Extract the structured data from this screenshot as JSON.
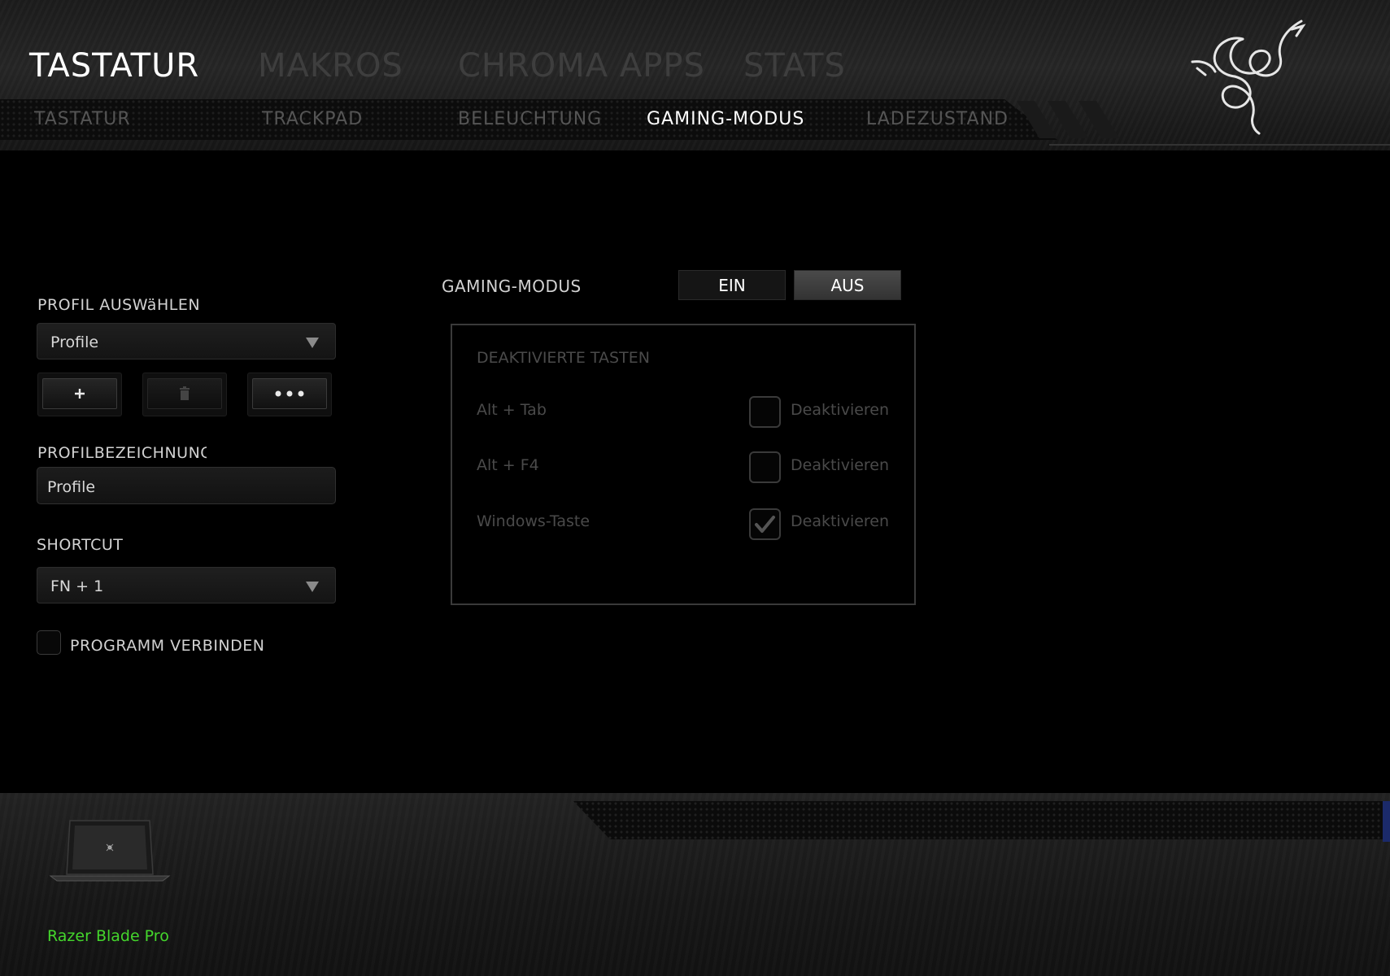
{
  "main_tabs": [
    {
      "label": "TASTATUR",
      "active": true
    },
    {
      "label": "MAKROS",
      "active": false
    },
    {
      "label": "CHROMA APPS",
      "active": false
    },
    {
      "label": "STATS",
      "active": false
    }
  ],
  "sub_tabs": [
    {
      "label": "TASTATUR",
      "active": false
    },
    {
      "label": "TRACKPAD",
      "active": false
    },
    {
      "label": "BELEUCHTUNG",
      "active": false
    },
    {
      "label": "GAMING-MODUS",
      "active": true
    },
    {
      "label": "LADEZUSTAND",
      "active": false
    }
  ],
  "profile": {
    "select_label": "PROFIL AUSWäHLEN",
    "selected": "Profile",
    "add_icon": "plus-icon",
    "delete_icon": "trash-icon",
    "more_icon": "ellipsis-icon",
    "name_label": "PROFILBEZEICHNUNG",
    "name_value": "Profile",
    "shortcut_label": "SHORTCUT",
    "shortcut_value": "FN + 1",
    "link_program_label": "PROGRAMM VERBINDEN",
    "link_program_checked": false
  },
  "gaming_mode": {
    "label": "GAMING-MODUS",
    "on_label": "EIN",
    "off_label": "AUS",
    "state": "AUS",
    "panel_title": "DEAKTIVIERTE TASTEN",
    "keys": [
      {
        "name": "Alt + Tab",
        "option": "Deaktivieren",
        "checked": false
      },
      {
        "name": "Alt + F4",
        "option": "Deaktivieren",
        "checked": false
      },
      {
        "name": "Windows-Taste",
        "option": "Deaktivieren",
        "checked": true
      }
    ]
  },
  "device": {
    "name": "Razer Blade Pro",
    "icon": "laptop-icon"
  },
  "colors": {
    "accent_green": "#44d62c",
    "background": "#000000",
    "active_text": "#ffffff",
    "inactive_text": "#3e3e3e"
  }
}
